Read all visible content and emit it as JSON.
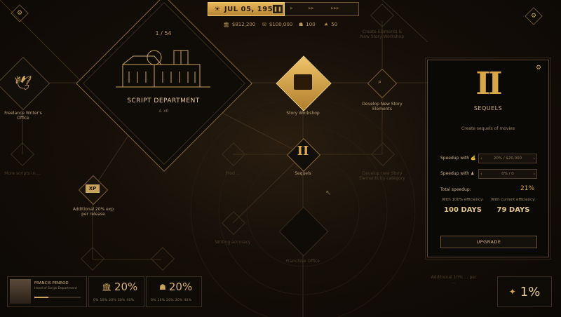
{
  "top_bar": {
    "date": "JUL 05, 1955",
    "money": "$812,200",
    "cash": "$100,000",
    "staff": "100",
    "stars": "50"
  },
  "tree": {
    "counter": "1 / 54",
    "department_title": "SCRIPT DEPARTMENT",
    "department_sub": "♙ x0",
    "nodes": {
      "freelance": "Freelance Writer's Office",
      "story_workshop": "Story Workshop",
      "develop_story": "Develop New Story Elements",
      "top_right_node": "Create Elements & New Story Workshop",
      "sequels": "Sequels",
      "additional_xp": "Additional 20% exp per release",
      "mid_left": "More scripts in ...",
      "fruit_node": "Prod ...",
      "develop_category": "Develop new Story Elements by category",
      "writing_node": "Writing accuracy",
      "franchise": "Franchise Office",
      "additional_bottom_right": "Additional 10% ... per ...",
      "xp_badge": "XP",
      "sequels_numeral": "II"
    }
  },
  "panel": {
    "numeral": "II",
    "title": "SEQUELS",
    "description": "Create sequels of movies",
    "speedup_money_label": "Speedup with 💰",
    "speedup_money_value": "20% / $20,000",
    "speedup_staff_label": "Speedup with ♟",
    "speedup_staff_value": "0% / 0",
    "total_label": "Total speedup:",
    "total_value": "21%",
    "eff_full_label": "With 100% efficiency:",
    "eff_full_value": "100 DAYS",
    "eff_current_label": "With current efficiency:",
    "eff_current_value": "79 DAYS",
    "upgrade": "UPGRADE"
  },
  "bottom": {
    "person_name": "FRANCIS PENROD",
    "person_role": "Head of Script Department",
    "stat1": "20%",
    "stat2": "20%",
    "scale": "0%  10%  20%  30%  40%",
    "corner_pct": "1%"
  },
  "colors": {
    "gold": "#d4a44a",
    "background": "#160f08",
    "panel_bg": "#0b0906"
  }
}
